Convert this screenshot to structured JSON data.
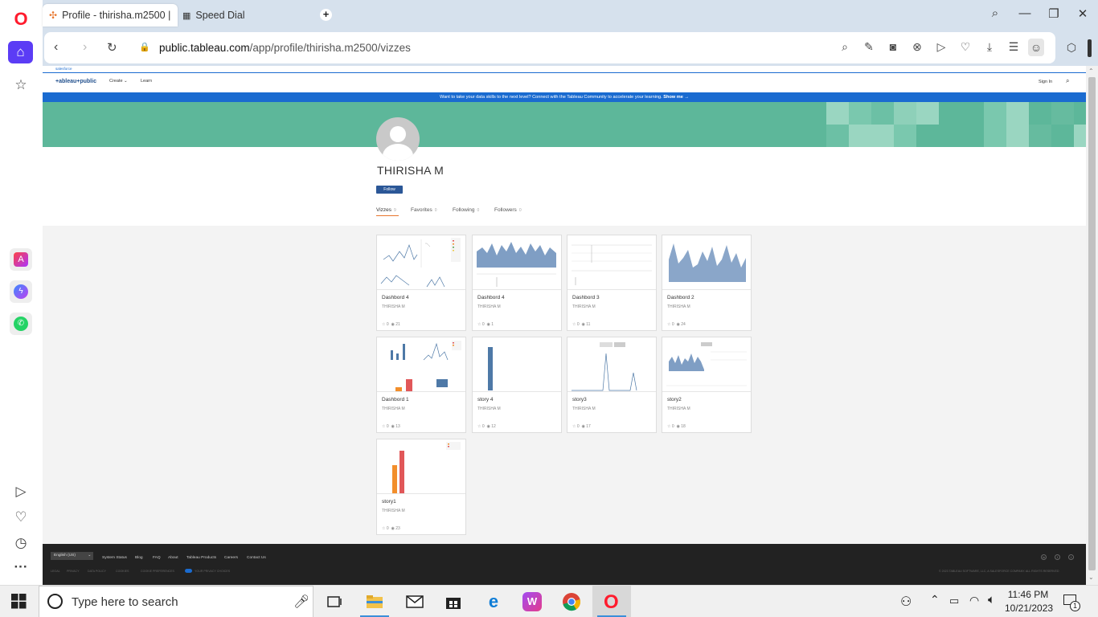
{
  "browser": {
    "tabs": [
      {
        "title": "Profile - thirisha.m2500 | T"
      },
      {
        "title": "Speed Dial"
      }
    ],
    "url": {
      "host": "public.tableau.com",
      "path": "/app/profile/thirisha.m2500/vizzes"
    }
  },
  "site": {
    "salesforce_label": "salesforce",
    "logo": "+ableau+public",
    "nav": {
      "create": "Create",
      "learn": "Learn",
      "sign_in": "Sign In"
    },
    "promo": "Want to take your data skills to the next level? Connect with the Tableau Community to accelerate your learning.",
    "promo_cta": "Show me →"
  },
  "profile": {
    "name": "THIRISHA M",
    "follow": "Follow",
    "tabs": [
      {
        "label": "Vizzes",
        "count": "9"
      },
      {
        "label": "Favorites",
        "count": "0"
      },
      {
        "label": "Following",
        "count": "0"
      },
      {
        "label": "Followers",
        "count": "0"
      }
    ]
  },
  "vizzes": [
    {
      "title": "Dashbord 4",
      "author": "THIRISHA M",
      "favorites": "0",
      "views": "21"
    },
    {
      "title": "Dashbord 4",
      "author": "THIRISHA M",
      "favorites": "0",
      "views": "1"
    },
    {
      "title": "Dashbord 3",
      "author": "THIRISHA M",
      "favorites": "0",
      "views": "11"
    },
    {
      "title": "Dashbord 2",
      "author": "THIRISHA M",
      "favorites": "0",
      "views": "24"
    },
    {
      "title": "Dashbord 1",
      "author": "THIRISHA M",
      "favorites": "0",
      "views": "13"
    },
    {
      "title": "story 4",
      "author": "THIRISHA M",
      "favorites": "0",
      "views": "12"
    },
    {
      "title": "story3",
      "author": "THIRISHA M",
      "favorites": "0",
      "views": "17"
    },
    {
      "title": "story2",
      "author": "THIRISHA M",
      "favorites": "0",
      "views": "18"
    },
    {
      "title": "story1",
      "author": "THIRISHA M",
      "favorites": "0",
      "views": "23"
    }
  ],
  "footer": {
    "language": "English (US)",
    "links": [
      "System Status",
      "Blog",
      "FAQ",
      "About",
      "Tableau Products",
      "Careers",
      "Contact Us"
    ],
    "legal": [
      "LEGAL",
      "PRIVACY",
      "DATA POLICY",
      "COOKIES",
      "COOKIE PREFERENCES",
      "YOUR PRIVACY CHOICES"
    ],
    "copyright": "© 2023 TABLEAU SOFTWARE, LLC, A SALESFORCE COMPANY. ALL RIGHTS RESERVED"
  },
  "taskbar": {
    "search_placeholder": "Type here to search",
    "time": "11:46 PM",
    "date": "10/21/2023",
    "notifications": "1"
  },
  "colors": {
    "hero": "#5db79a",
    "promo": "#1a6bd0",
    "follow": "#2b5797",
    "accent": "#e8762d",
    "opera": "#ff1b2d"
  }
}
